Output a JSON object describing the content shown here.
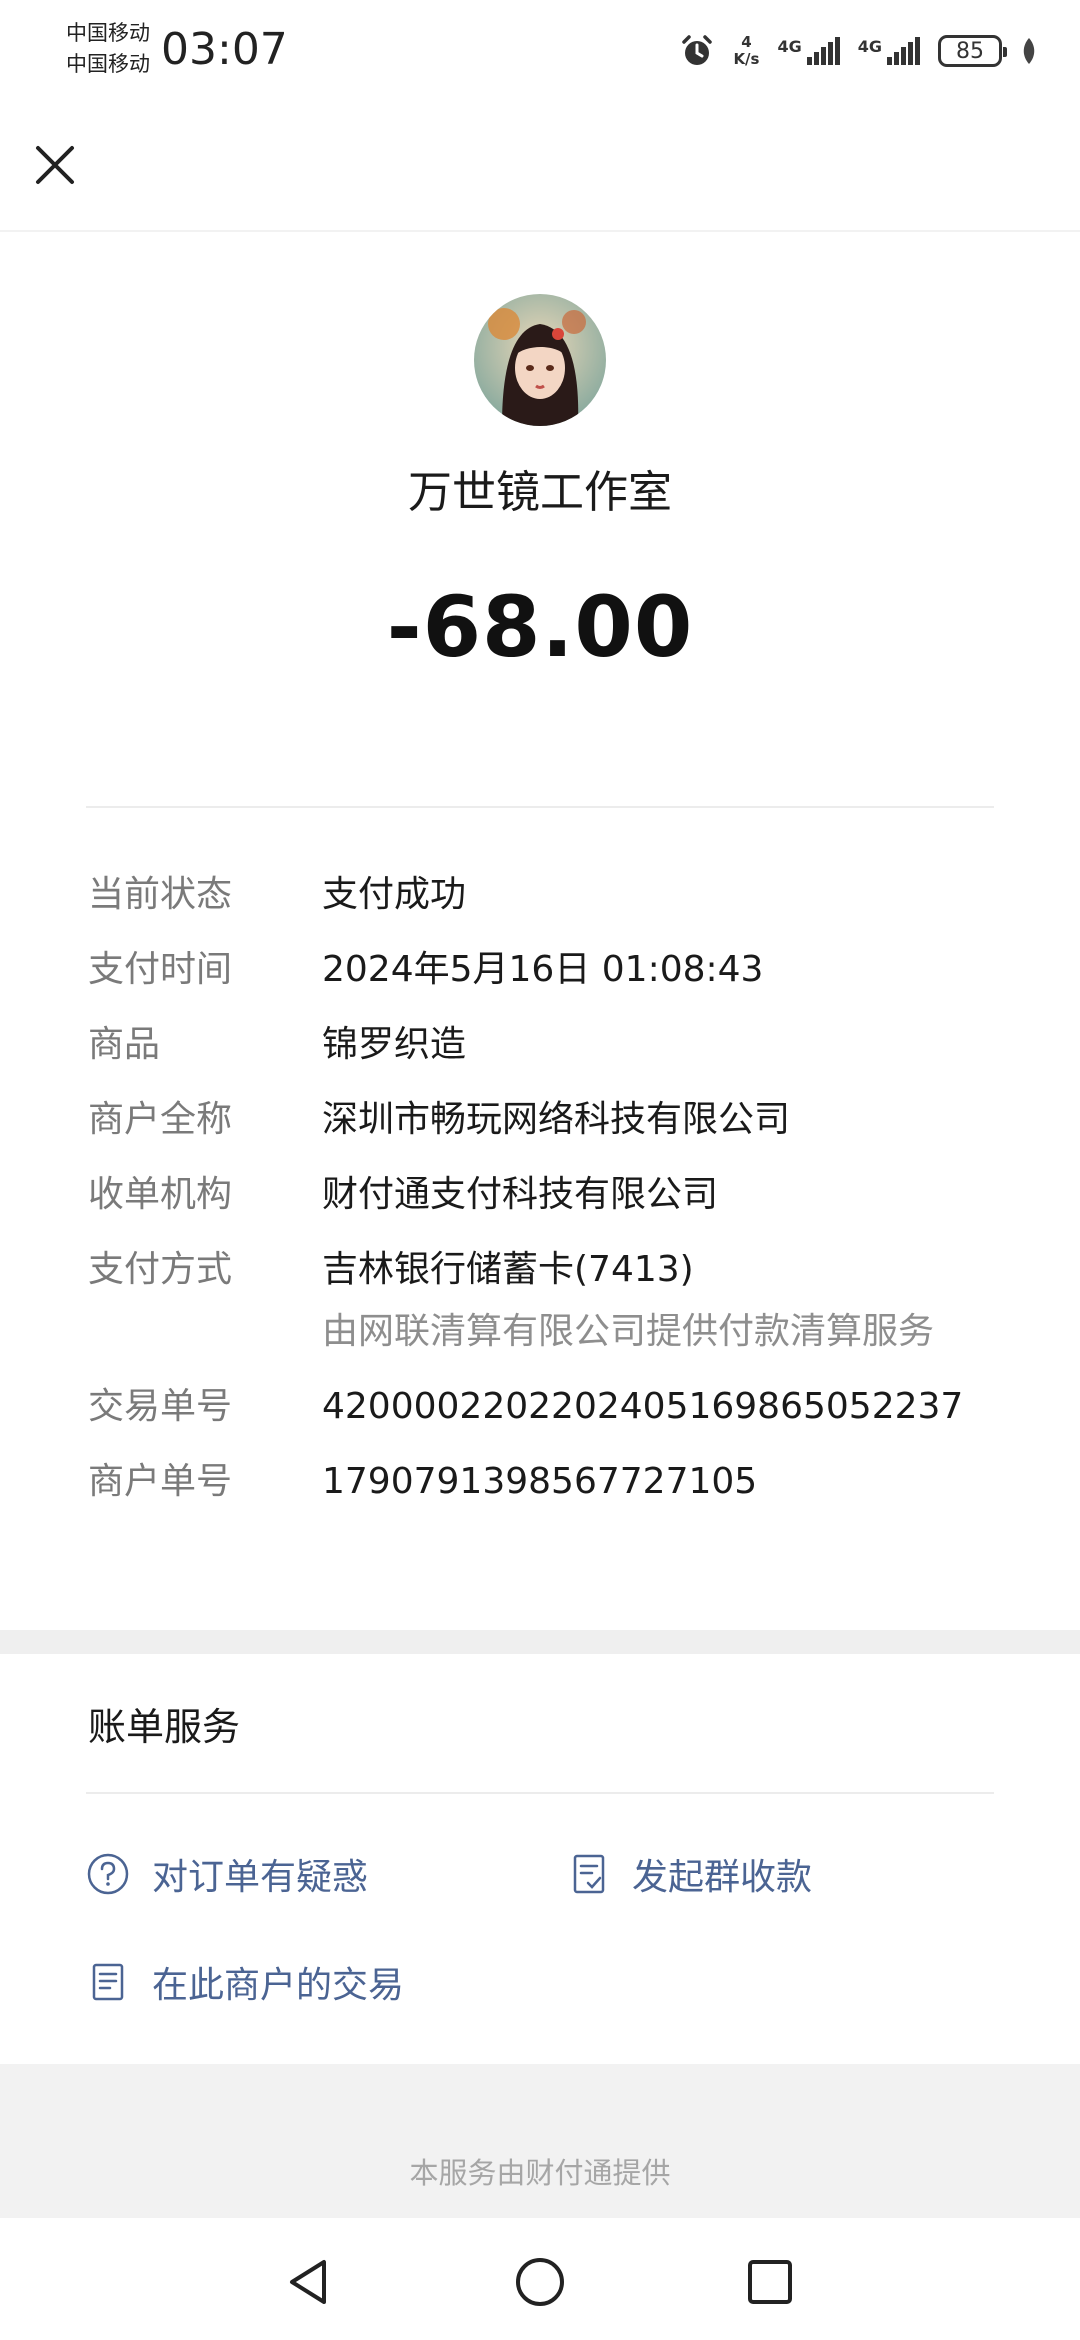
{
  "status_bar": {
    "carrier_1": "中国移动",
    "carrier_2": "中国移动",
    "time": "03:07",
    "speed_value": "4",
    "speed_unit": "K/s",
    "network_1": "4G",
    "network_2": "4G",
    "battery": "85",
    "icons": [
      "alarm-icon",
      "signal-icon",
      "battery-icon",
      "leaf-icon"
    ]
  },
  "header": {
    "close_icon": "close-icon"
  },
  "merchant": {
    "name": "万世镜工作室",
    "amount": "-68.00"
  },
  "details": [
    {
      "label": "当前状态",
      "value": "支付成功"
    },
    {
      "label": "支付时间",
      "value": "2024年5月16日 01:08:43"
    },
    {
      "label": "商品",
      "value": "锦罗织造"
    },
    {
      "label": "商户全称",
      "value": "深圳市畅玩网络科技有限公司"
    },
    {
      "label": "收单机构",
      "value": "财付通支付科技有限公司"
    },
    {
      "label": "支付方式",
      "value": "吉林银行储蓄卡(7413)",
      "sub": "由网联清算有限公司提供付款清算服务"
    },
    {
      "label": "交易单号",
      "value": "4200002202202405169865052237"
    },
    {
      "label": "商户单号",
      "value": "1790791398567727105"
    }
  ],
  "services": {
    "title": "账单服务",
    "items": [
      {
        "label": "对订单有疑惑",
        "icon": "question-icon"
      },
      {
        "label": "发起群收款",
        "icon": "group-collect-icon"
      },
      {
        "label": "在此商户的交易",
        "icon": "document-icon"
      }
    ]
  },
  "footer": {
    "text": "本服务由财付通提供"
  },
  "nav": {
    "icons": [
      "back-icon",
      "home-icon",
      "recents-icon"
    ]
  },
  "colors": {
    "link": "#4b6493",
    "label": "#7a7a7a",
    "footer_bg": "#f2f2f2"
  }
}
